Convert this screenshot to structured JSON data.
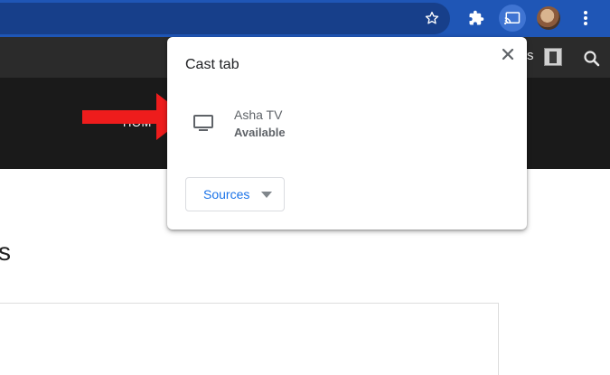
{
  "browser": {
    "toolbar_color": "#1f56b6",
    "icons": {
      "star": "star-icon",
      "extensions": "puzzle-icon",
      "cast": "cast-icon",
      "menu": "kebab-menu-icon"
    }
  },
  "website": {
    "nav_home_label": "HOM",
    "topbar_partial_text": "s",
    "heading_partial": "s"
  },
  "cast_popup": {
    "title": "Cast tab",
    "close_icon": "close-icon",
    "devices": [
      {
        "name": "Asha TV",
        "status": "Available",
        "icon": "tv-icon"
      }
    ],
    "sources_label": "Sources",
    "accent_color": "#1a73e8"
  },
  "annotation": {
    "arrow_color": "#ee1c1c"
  }
}
